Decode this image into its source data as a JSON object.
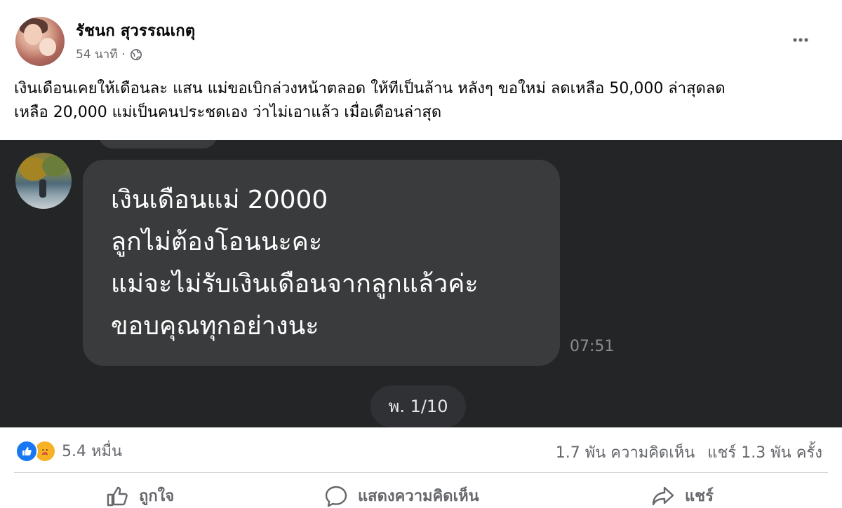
{
  "post": {
    "author": "รัชนก สุวรรณเกตุ",
    "time": "54 นาที",
    "separator": "·",
    "menu_icon": "more-horizontal-icon",
    "caption_line1": "เงินเดือนเคยให้เดือนละ แสน แม่ขอเบิกล่วงหน้าตลอด ให้ทีเป็นล้าน  หลังๆ ขอใหม่ ลดเหลือ 50,000 ล่าสุดลด",
    "caption_line2": "เหลือ 20,000 แม่เป็นคนประชดเอง ว่าไม่เอาแล้ว เมื่อเดือนล่าสุด"
  },
  "chat": {
    "message_lines": [
      "เงินเดือนแม่ 20000",
      "ลูกไม่ต้องโอนนะคะ",
      "แม่จะไม่รับเงินเดือนจากลูกแล้วค่ะ",
      "ขอบคุณทุกอย่างนะ"
    ],
    "time": "07:51",
    "pager": "พ. 1/10"
  },
  "engagement": {
    "reaction_count": "5.4 หมื่น",
    "comments": "1.7 พัน ความคิดเห็น",
    "shares": "แชร์ 1.3 พัน ครั้ง"
  },
  "actions": {
    "like": "ถูกใจ",
    "comment": "แสดงความคิดเห็น",
    "share": "แชร์"
  },
  "colors": {
    "accent": "#1877f2",
    "chat_background": "#242526",
    "bubble": "#3a3b3c",
    "muted_text": "#65676b"
  }
}
